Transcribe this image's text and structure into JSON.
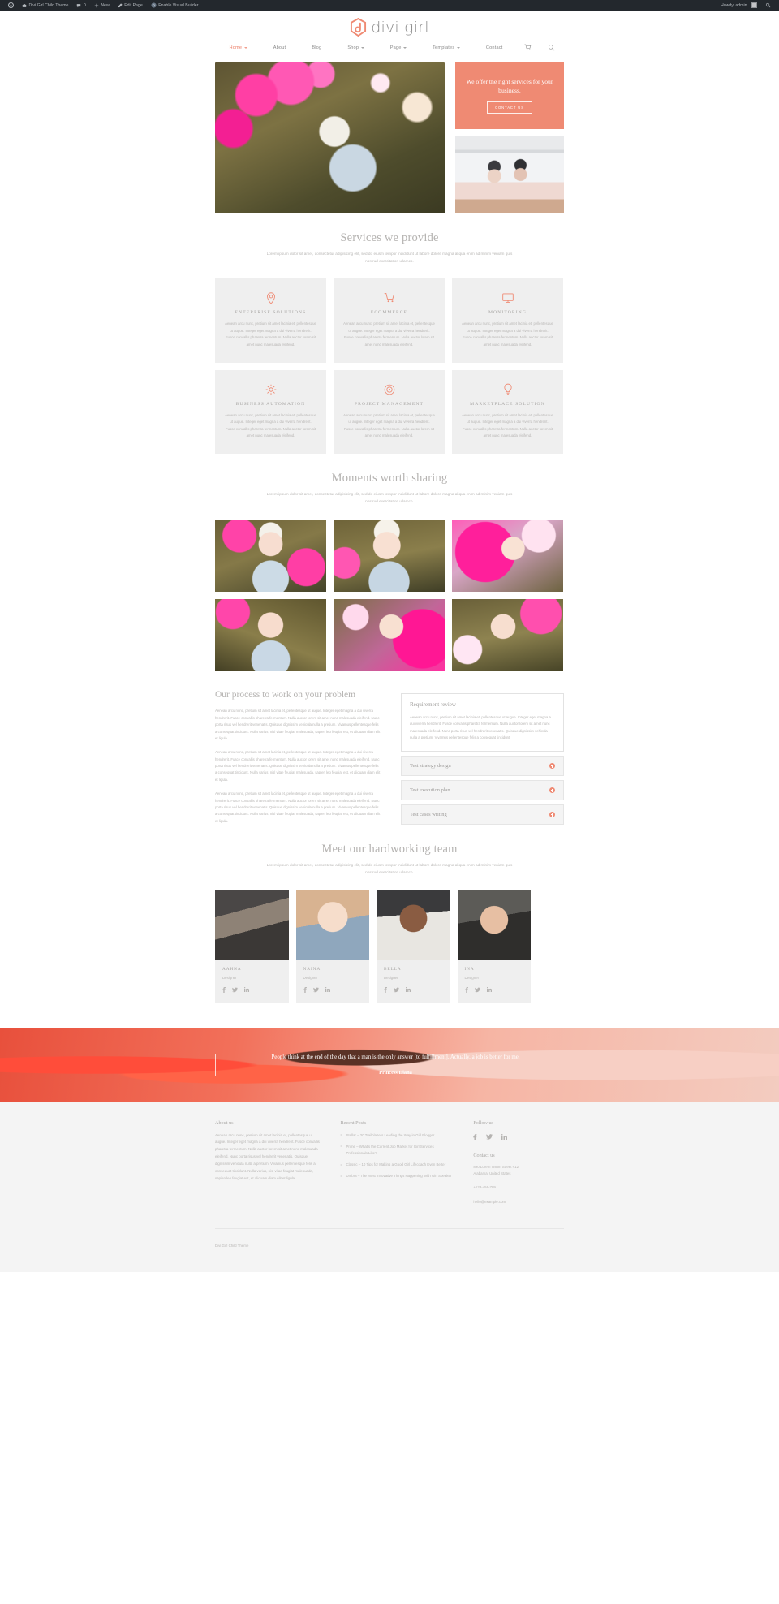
{
  "admin_bar": {
    "wp_logo": "wordpress-logo",
    "site_name": "Divi Girl Child Theme",
    "comments_count": "0",
    "new_label": "New",
    "edit_page_label": "Edit Page",
    "visual_builder_label": "Enable Visual Builder",
    "howdy": "Howdy, admin",
    "search_icon": "search-icon"
  },
  "header": {
    "logo_text": "divi girl",
    "nav": [
      {
        "label": "Home",
        "has_dropdown": true,
        "active": true
      },
      {
        "label": "About",
        "has_dropdown": false,
        "active": false
      },
      {
        "label": "Blog",
        "has_dropdown": false,
        "active": false
      },
      {
        "label": "Shop",
        "has_dropdown": true,
        "active": false
      },
      {
        "label": "Page",
        "has_dropdown": true,
        "active": false
      },
      {
        "label": "Templates",
        "has_dropdown": true,
        "active": false
      },
      {
        "label": "Contact",
        "has_dropdown": false,
        "active": false
      }
    ],
    "cart_icon": "shopping-cart-icon",
    "search_icon": "search-icon"
  },
  "hero": {
    "cta_title": "We offer the right services for your business.",
    "cta_button": "CONTACT US"
  },
  "services": {
    "title": "Services we provide",
    "subtitle": "Lorem ipsum dolor sit amet, consectetur adipisicing elit, sed do eiusm tempor incididunt ut labore dolore magna aliqua enim ad minim veniam quis nostrud exercitation ullamco.",
    "body_text": "Aenean arcu nunc, pretium sit amet lacinia et, pellentesque ut augue. Integer eget magna a dui viverra hendrerit. Fusce convallis pharetra fermentum. Nulla auctor lorem sit amet nunc malesuada eleifend.",
    "cards": [
      {
        "name": "ENTERPRISE SOLUTIONS",
        "icon": "map-pin-icon"
      },
      {
        "name": "ECOMMERCE",
        "icon": "shopping-cart-icon"
      },
      {
        "name": "MONITORING",
        "icon": "monitor-icon"
      },
      {
        "name": "BUSINESS AUTOMATION",
        "icon": "gear-icon"
      },
      {
        "name": "PROJECT MANAGEMENT",
        "icon": "target-icon"
      },
      {
        "name": "MARKETPLACE SOLUTION",
        "icon": "lightbulb-icon"
      }
    ]
  },
  "gallery": {
    "title": "Moments worth sharing",
    "subtitle": "Lorem ipsum dolor sit amet, consectetur adipisicing elit, sed do eiusm tempor incididunt ut labore dolore magna aliqua enim ad minim veniam quis nostrud exercitation ullamco.",
    "images": [
      "gallery-image-1",
      "gallery-image-2",
      "gallery-image-3",
      "gallery-image-4",
      "gallery-image-5",
      "gallery-image-6"
    ]
  },
  "process": {
    "title": "Our process to work on your problem",
    "paragraph": "Aenean arcu nunc, pretium sit amet lacinia et, pellentesque ut augue. Integer eget magna a dui viverra hendrerit. Fusce convallis pharetra fermentum. Nulla auctor lorem sit amet nunc malesuada eleifend. Nunc porta risus vel hendrerit venenatis. Quisque dignissim vehicula nulla a pretium. Vivamus pellentesque felis a consequat tincidunt. Nulla varius, nisl vitae feugiat malesuada, sapien leo feugiat est, et aliquam diam elit et ligula.",
    "accordion": [
      {
        "title": "Requirement review",
        "open": true,
        "body": "Aenean arcu nunc, pretium sit amet lacinia et, pellentesque ut augue. Integer eget magna a dui viverra hendrerit. Fusce convallis pharetra fermentum. Nulla auctor lorem sit amet nunc malesuada eleifend. Nunc porta risus vel hendrerit venenatis. Quisque dignissim vehicula nulla a pretium. Vivamus pellentesque felis a consequat tincidunt."
      },
      {
        "title": "Test strategy design",
        "open": false
      },
      {
        "title": "Test execution plan",
        "open": false
      },
      {
        "title": "Test cases writing",
        "open": false
      }
    ]
  },
  "team": {
    "title": "Meet our hardworking team",
    "subtitle": "Lorem ipsum dolor sit amet, consectetur adipisicing elit, sed do eiusm tempor incididunt ut labore dolore magna aliqua enim ad minim veniam quis nostrud exercitation ullamco.",
    "members": [
      {
        "name": "AAHNA",
        "role": "Designer"
      },
      {
        "name": "NAINA",
        "role": "Designer"
      },
      {
        "name": "BELLA",
        "role": "Designer"
      },
      {
        "name": "INA",
        "role": "Designer"
      }
    ],
    "socials": [
      "facebook-icon",
      "twitter-icon",
      "linkedin-icon"
    ]
  },
  "quote": {
    "text": "People think at the end of the day that a man is the only answer [to fulfillment]. Actually, a job is better for me.",
    "author": "Princess Diana"
  },
  "footer": {
    "about": {
      "heading": "About us",
      "text": "Aenean arcu nunc, pretium sit amet lacinia et, pellentesque ut augue. Integer eget magna a dui viverra hendrerit. Fusce convallis pharetra fermentum. Nulla auctor lorem sit amet nunc malesuada eleifend. Nunc porta risus vel hendrerit venenatis. Quisque dignissim vehicula nulla a pretium. Vivamus pellentesque felis a consequat tincidunt. Nulla varius, nisl vitae feugiat malesuada, sapien leo feugiat est, et aliquam diam elit et ligula."
    },
    "recent_posts": {
      "heading": "Recent Posts",
      "items": [
        "Stellar – 20 Trailblazers Leading the Way in Girl Blogger",
        "Prime – What's the Current Job Market for Girl Services Professionals Like?",
        "Classic – 10 Tips for Making a Good Girl Lifecoach Even Better",
        "Umbra – The Most Innovative Things Happening With Girl Speaker"
      ]
    },
    "follow": {
      "heading": "Follow us",
      "socials": [
        "facebook-icon",
        "twitter-icon",
        "linkedin-icon"
      ]
    },
    "contact": {
      "heading": "Contact us",
      "address_line1": "890 Lorem Ipsum Street #12",
      "address_line2": "Alabama, United States",
      "phone": "+123-456-789",
      "email": "hello@example.com"
    },
    "copyright": "Divi Girl Child Theme"
  },
  "colors": {
    "accent": "#ef8a73",
    "admin_bar_bg": "#23282d",
    "card_bg": "#efefef",
    "footer_bg": "#f4f4f4"
  }
}
